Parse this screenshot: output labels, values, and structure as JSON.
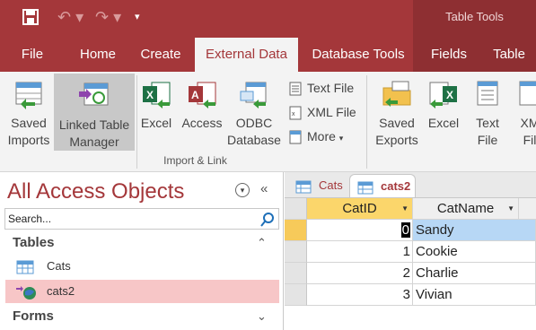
{
  "title_bar": {
    "contextual_title": "Table Tools",
    "qat": {
      "save_icon": "save-icon",
      "undo_icon": "undo-icon",
      "redo_icon": "redo-icon",
      "customize_icon": "customize-qat-icon"
    }
  },
  "tabs": [
    {
      "label": "File",
      "active": false
    },
    {
      "label": "Home",
      "active": false
    },
    {
      "label": "Create",
      "active": false
    },
    {
      "label": "External Data",
      "active": true
    },
    {
      "label": "Database Tools",
      "active": false
    },
    {
      "label": "Fields",
      "active": false
    },
    {
      "label": "Table",
      "active": false
    }
  ],
  "ribbon": {
    "saved_imports": {
      "line1": "Saved",
      "line2": "Imports"
    },
    "linked_table_manager": {
      "line1": "Linked Table",
      "line2": "Manager"
    },
    "excel_import": "Excel",
    "access_import": "Access",
    "odbc": {
      "line1": "ODBC",
      "line2": "Database"
    },
    "text_file": "Text File",
    "xml_file": "XML File",
    "more": "More",
    "group_label": "Import & Link",
    "saved_exports": {
      "line1": "Saved",
      "line2": "Exports"
    },
    "excel_export": "Excel",
    "text_export": {
      "line1": "Text",
      "line2": "File"
    },
    "xml_export": {
      "line1": "XM",
      "line2": "Fil"
    }
  },
  "nav": {
    "title": "All Access Objects",
    "search_placeholder": "Search...",
    "groups": [
      {
        "label": "Tables",
        "chevron": "⌃"
      },
      {
        "label": "Forms",
        "chevron": "⌄"
      }
    ],
    "items": [
      {
        "label": "Cats",
        "icon": "table-icon",
        "selected": false
      },
      {
        "label": "cats2",
        "icon": "linked-table-icon",
        "selected": true
      }
    ]
  },
  "document": {
    "tabs": [
      {
        "label": "Cats",
        "active": false
      },
      {
        "label": "cats2",
        "active": true
      }
    ],
    "columns": [
      "CatID",
      "CatName"
    ],
    "rows": [
      {
        "id": "0",
        "name": "Sandy"
      },
      {
        "id": "1",
        "name": "Cookie"
      },
      {
        "id": "2",
        "name": "Charlie"
      },
      {
        "id": "3",
        "name": "Vivian"
      }
    ]
  },
  "colors": {
    "accent": "#a4373a",
    "ribbon": "#f3f3f3",
    "selected_row": "#b7d7f5",
    "sorted_header": "#fbd66b"
  }
}
